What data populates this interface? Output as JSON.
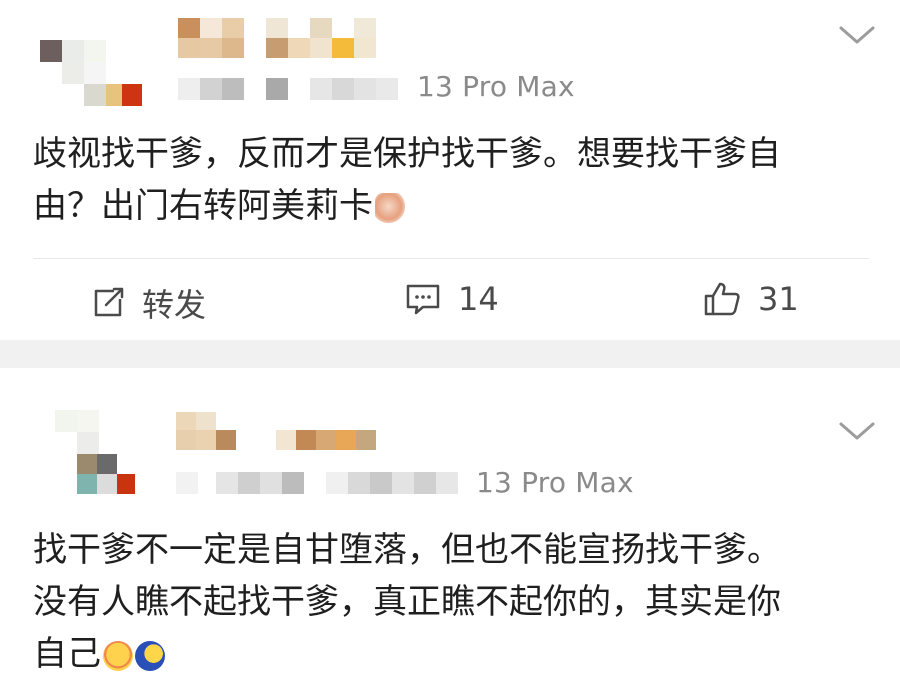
{
  "posts": [
    {
      "device": "13 Pro Max",
      "content_line1": "歧视找干爹，反而才是保护找干爹。想要找干爹自",
      "content_line2": "由？出门右转阿美莉卡",
      "emoji": "hands-emoji",
      "actions": {
        "repost_label": "转发",
        "comment_count": "14",
        "like_count": "31"
      }
    },
    {
      "device": "13 Pro Max",
      "content_line1": "找干爹不一定是自甘堕落，但也不能宣扬找干爹。",
      "content_line2": "没有人瞧不起找干爹，真正瞧不起你的，其实是你",
      "content_line3": "自己",
      "emojis": [
        "hug-emoji",
        "moon-emoji"
      ]
    }
  ],
  "colors": {
    "text": "#1f1f1f",
    "secondary": "#8a8a8a",
    "separator": "#f1f1f1"
  }
}
